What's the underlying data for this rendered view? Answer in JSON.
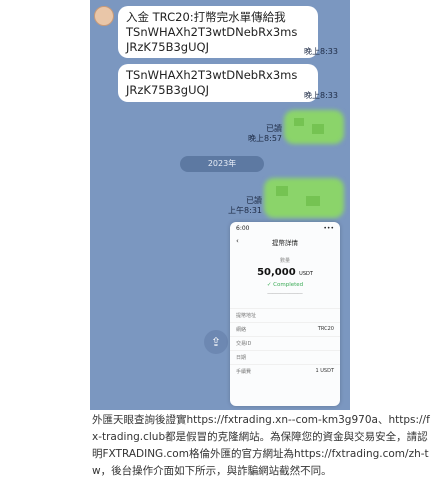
{
  "chat": {
    "message1": {
      "text": "入金 TRC20:打幣完水單傳給我 TSnWHAXh2T3wtDNebRx3ms JRzK75B3gUQJ",
      "time": "晚上8:33"
    },
    "message2": {
      "text": "TSnWHAXh2T3wtDNebRx3ms JRzK75B3gUQJ",
      "time": "晚上8:33"
    },
    "message3": {
      "status": "已讀",
      "time": "晚上8:57"
    },
    "date_chip": "2023年",
    "message4": {
      "status": "已讀",
      "time": "上午8:31"
    },
    "share_icon": "share-icon"
  },
  "receipt": {
    "status_time": "6:00",
    "status_icons": "•••",
    "title": "提幣詳情",
    "back_symbol": "‹",
    "amount_label": "數量",
    "amount": "50,000",
    "amount_unit": "USDT",
    "status": "Completed",
    "rows": [
      {
        "label": "提幣地址",
        "value": ""
      },
      {
        "label": "網絡",
        "value": "TRC20"
      },
      {
        "label": "交易ID",
        "value": ""
      },
      {
        "label": "日期",
        "value": ""
      },
      {
        "label": "手續費",
        "value": "1 USDT"
      }
    ]
  },
  "caption": "外匯天眼查詢後證實https://fxtrading.xn--com-km3g970a、https://fx-trading.club都是假冒的克隆網站。為保障您的資金與交易安全，請認明FXTRADING.com格倫外匯的官方網址為https://fxtrading.com/zh-tw，後台操作介面如下所示，與詐騙網站截然不同。"
}
